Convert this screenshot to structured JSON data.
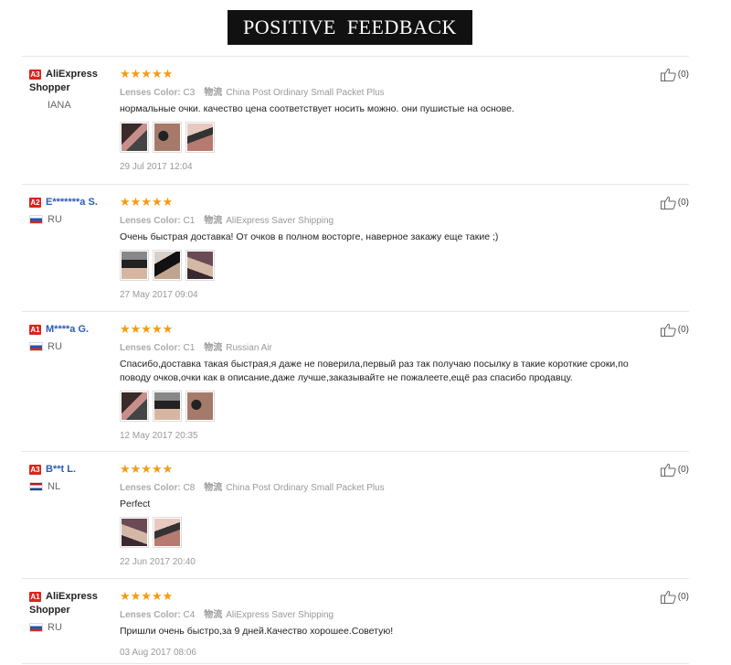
{
  "banner": {
    "title": "POSITIVE  FEEDBACK"
  },
  "labels": {
    "lenses_color": "Lenses Color:",
    "logistics": "物流"
  },
  "reviews": [
    {
      "level": "A3",
      "name": "AliExpress Shopper",
      "country": "IANA",
      "flag": "",
      "stars": "★★★★★",
      "color": "C3",
      "shipping": "China Post Ordinary Small Packet Plus",
      "text": "нормальные очки. качество цена соответствует носить можно. они пушистые на основе.",
      "photos": [
        "p1",
        "p2",
        "p3"
      ],
      "date": "29 Jul 2017 12:04",
      "useful": "(0)"
    },
    {
      "level": "A2",
      "name": "E*******a S.",
      "country": "RU",
      "flag": "ru",
      "stars": "★★★★★",
      "color": "C1",
      "shipping": "AliExpress Saver Shipping",
      "text": "Очень быстрая доставка! От очков в полном восторге, наверное закажу еще такие ;)",
      "photos": [
        "p4",
        "p5",
        "p6"
      ],
      "date": "27 May 2017 09:04",
      "useful": "(0)"
    },
    {
      "level": "A1",
      "name": "M****a G.",
      "country": "RU",
      "flag": "ru",
      "stars": "★★★★★",
      "color": "C1",
      "shipping": "Russian Air",
      "text": "Спасибо,доставка такая быстрая,я даже не поверила,первый раз так получаю посылку в такие короткие сроки,по поводу очков,очки как в описание,даже лучше,заказывайте не пожалеете,ещё раз спасибо продавцу.",
      "photos": [
        "p1",
        "p4",
        "p2"
      ],
      "date": "12 May 2017 20:35",
      "useful": "(0)"
    },
    {
      "level": "A3",
      "name": "B**t L.",
      "country": "NL",
      "flag": "nl",
      "stars": "★★★★★",
      "color": "C8",
      "shipping": "China Post Ordinary Small Packet Plus",
      "text": "Perfect",
      "photos": [
        "p6",
        "p3"
      ],
      "date": "22 Jun 2017 20:40",
      "useful": "(0)"
    },
    {
      "level": "A1",
      "name": "AliExpress Shopper",
      "country": "RU",
      "flag": "ru",
      "stars": "★★★★★",
      "color": "C4",
      "shipping": "AliExpress Saver Shipping",
      "text": "Пришли очень быстро,за 9 дней.Качество хорошее.Советую!",
      "photos": [],
      "date": "03 Aug 2017 08:06",
      "useful": "(0)"
    }
  ]
}
